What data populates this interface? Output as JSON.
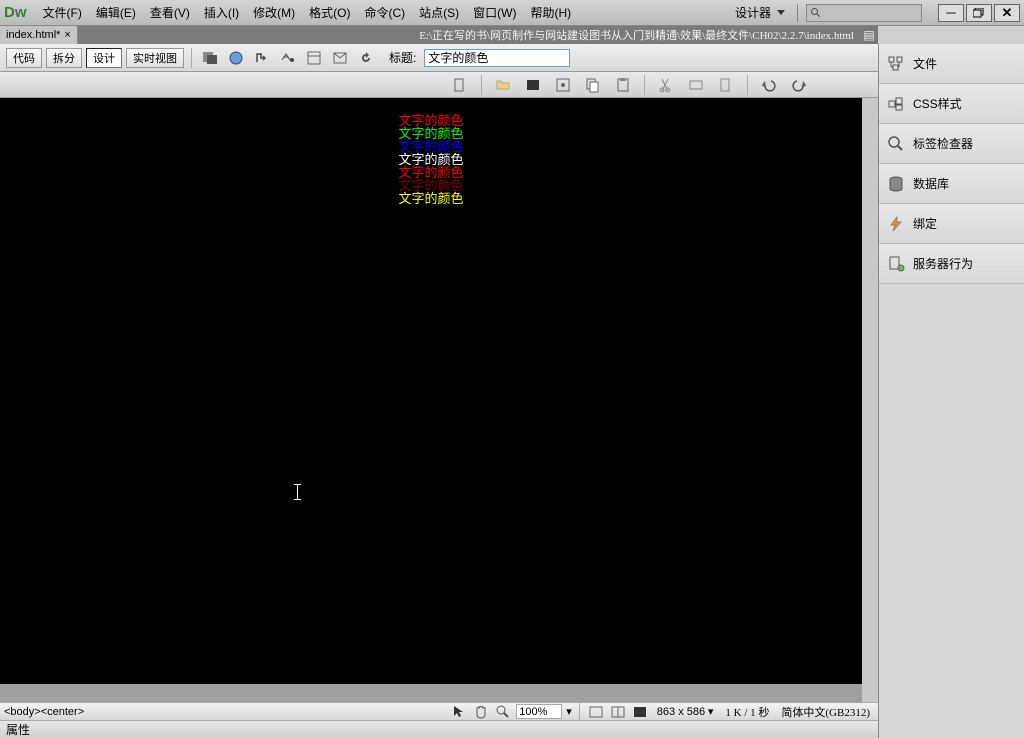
{
  "app": {
    "logo": "Dw"
  },
  "menu": [
    {
      "label": "文件(F)"
    },
    {
      "label": "编辑(E)"
    },
    {
      "label": "查看(V)"
    },
    {
      "label": "插入(I)"
    },
    {
      "label": "修改(M)"
    },
    {
      "label": "格式(O)"
    },
    {
      "label": "命令(C)"
    },
    {
      "label": "站点(S)"
    },
    {
      "label": "窗口(W)"
    },
    {
      "label": "帮助(H)"
    }
  ],
  "designer_label": "设计器",
  "tab": {
    "name": "index.html*"
  },
  "filepath": "E:\\正在写的书\\网页制作与网站建设图书从入门到精通\\效果\\最终文件\\CH02\\2.2.7\\index.html",
  "viewbtns": {
    "code": "代码",
    "split": "拆分",
    "design": "设计",
    "live": "实时视图"
  },
  "title_label": "标题:",
  "title_value": "文字的颜色",
  "doc_lines": [
    {
      "text": "文字的颜色",
      "color": "#ff0000"
    },
    {
      "text": "文字的颜色",
      "color": "#00ff00"
    },
    {
      "text": "文字的颜色",
      "color": "#0000ff"
    },
    {
      "text": "文字的颜色",
      "color": "#ffffff"
    },
    {
      "text": "文字的颜色",
      "color": "#ff0000"
    },
    {
      "text": "文字的颜色",
      "color": "#800000"
    },
    {
      "text": "文字的颜色",
      "color": "#ffff00"
    }
  ],
  "panels": [
    {
      "label": "文件",
      "icon": "files"
    },
    {
      "label": "CSS样式",
      "icon": "css"
    },
    {
      "label": "标签检查器",
      "icon": "tag"
    },
    {
      "label": "数据库",
      "icon": "db"
    },
    {
      "label": "绑定",
      "icon": "bind"
    },
    {
      "label": "服务器行为",
      "icon": "server"
    }
  ],
  "status": {
    "tagpath": "<body><center>",
    "zoom": "100%",
    "dims": "863 x 586",
    "size": "1 K / 1 秒",
    "encoding": "简体中文(GB2312)"
  },
  "properties_label": "属性"
}
